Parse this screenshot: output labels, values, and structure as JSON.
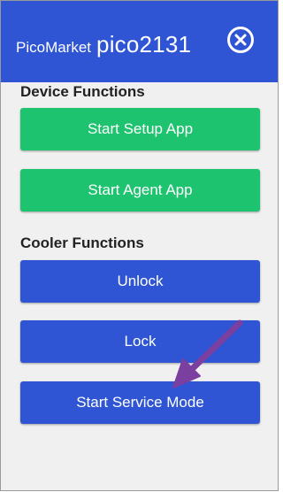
{
  "header": {
    "brand_small": "PicoMarket",
    "brand_large": "pico2131",
    "close_icon": "close-circle-icon"
  },
  "device_functions": {
    "title": "Device Functions",
    "buttons": [
      {
        "label": "Start Setup App"
      },
      {
        "label": "Start Agent App"
      }
    ]
  },
  "cooler_functions": {
    "title": "Cooler Functions",
    "buttons": [
      {
        "label": "Unlock"
      },
      {
        "label": "Lock"
      },
      {
        "label": "Start Service Mode"
      }
    ]
  },
  "colors": {
    "header": "#2f55d4",
    "green_button": "#1dc36e",
    "blue_button": "#2f55d4",
    "annotation_arrow": "#7b3fa0"
  }
}
